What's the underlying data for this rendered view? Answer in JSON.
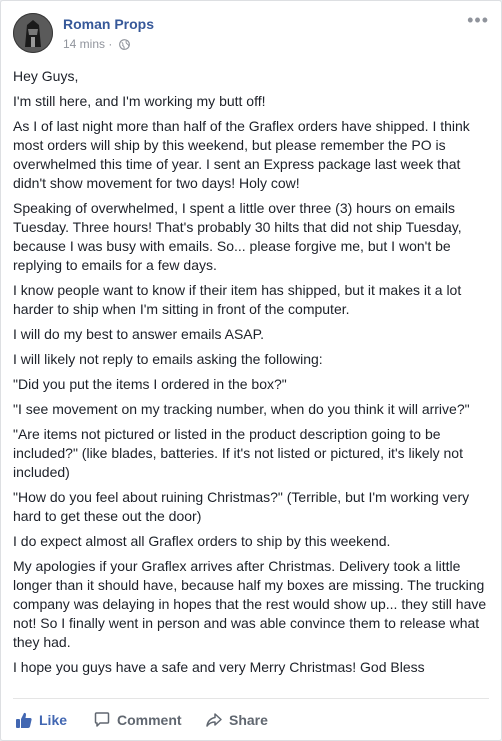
{
  "post": {
    "author": "Roman Props",
    "time": "14 mins",
    "separator": "·",
    "privacy_icon": "globe-icon",
    "menu_icon": "more-options-icon",
    "paragraphs": [
      "Hey Guys,",
      "I'm still here, and I'm working my butt off!",
      "As I of last night more than half of the Graflex orders have shipped. I think most orders will ship by this weekend, but please remember the PO is overwhelmed this time of year. I sent an Express package last week that didn't show movement for two days! Holy cow!",
      "Speaking of overwhelmed, I spent a little over three (3) hours on emails Tuesday. Three hours! That's probably 30 hilts that did not ship Tuesday, because I was busy with emails. So... please forgive me, but I won't be replying to emails for a few days.",
      "I know people want to know if their item has shipped, but it makes it a lot harder to ship when I'm sitting in front of the computer.",
      "I will do my best to answer emails ASAP.",
      "I will likely not reply to emails asking the following:",
      "\"Did you put the items I ordered in the box?\"",
      "\"I see movement on my tracking number, when do you think it will arrive?\"",
      "\"Are items not pictured or listed in the product description going to be included?\" (like blades, batteries. If it's not listed or pictured, it's likely not included)",
      "\"How do you feel about ruining Christmas?\" (Terrible, but I'm working very hard to get these out the door)",
      "I do expect almost all Graflex orders to ship by this weekend.",
      "My apologies if your Graflex arrives after Christmas. Delivery took a little longer than it should have, because half my boxes are missing. The trucking company was delaying in hopes that the rest would show up... they still have not! So I finally went in person and was able convince them to release what they had.",
      "I hope you guys have a safe and very Merry Christmas! God Bless"
    ]
  },
  "actions": {
    "like": "Like",
    "comment": "Comment",
    "share": "Share"
  },
  "colors": {
    "link": "#365899",
    "like_blue": "#4267b2",
    "text": "#1d2129",
    "muted": "#90949c"
  }
}
